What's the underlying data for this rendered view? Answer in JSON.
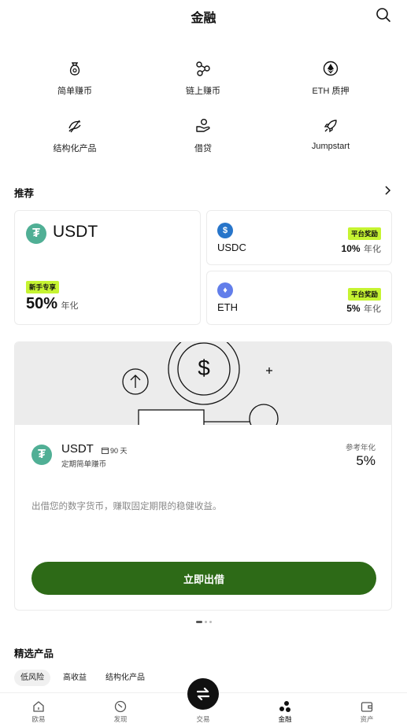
{
  "header": {
    "title": "金融",
    "search_icon": "search-icon"
  },
  "quick_actions": [
    {
      "label": "简单赚币",
      "icon": "money-bag-icon"
    },
    {
      "label": "链上赚币",
      "icon": "chain-nodes-icon"
    },
    {
      "label": "ETH 质押",
      "icon": "eth-stake-icon"
    },
    {
      "label": "结构化产品",
      "icon": "structured-product-icon"
    },
    {
      "label": "借贷",
      "icon": "loan-hand-icon"
    },
    {
      "label": "Jumpstart",
      "icon": "rocket-icon"
    }
  ],
  "recommend": {
    "title": "推荐",
    "main_card": {
      "coin": "USDT",
      "badge": "新手专享",
      "rate": "50%",
      "unit": "年化"
    },
    "side_cards": [
      {
        "coin": "USDC",
        "badge": "平台奖励",
        "rate": "10%",
        "unit": "年化"
      },
      {
        "coin": "ETH",
        "badge": "平台奖励",
        "rate": "5%",
        "unit": "年化"
      }
    ]
  },
  "carousel": {
    "coin": "USDT",
    "term": "90 天",
    "subtitle": "定期简单赚币",
    "ref_label": "参考年化",
    "rate": "5%",
    "description": "出借您的数字货币，赚取固定期限的稳健收益。",
    "cta": "立即出借",
    "dollar_symbol": "$",
    "plus_symbol": "+"
  },
  "featured": {
    "title": "精选产品",
    "filters": [
      "低风险",
      "高收益",
      "结构化产品"
    ],
    "active_filter": 0
  },
  "tabbar": {
    "tabs": [
      {
        "label": "欧易",
        "icon": "home-icon"
      },
      {
        "label": "发现",
        "icon": "discover-icon"
      },
      {
        "label": "交易",
        "icon": "trade-swap-icon"
      },
      {
        "label": "金融",
        "icon": "finance-dots-icon"
      },
      {
        "label": "资产",
        "icon": "wallet-icon"
      }
    ],
    "active": 3
  },
  "colors": {
    "accent_green": "#2d6a17",
    "badge_lime": "#c6f432",
    "tether": "#50af95",
    "usdc": "#2775ca",
    "eth": "#627eea"
  }
}
